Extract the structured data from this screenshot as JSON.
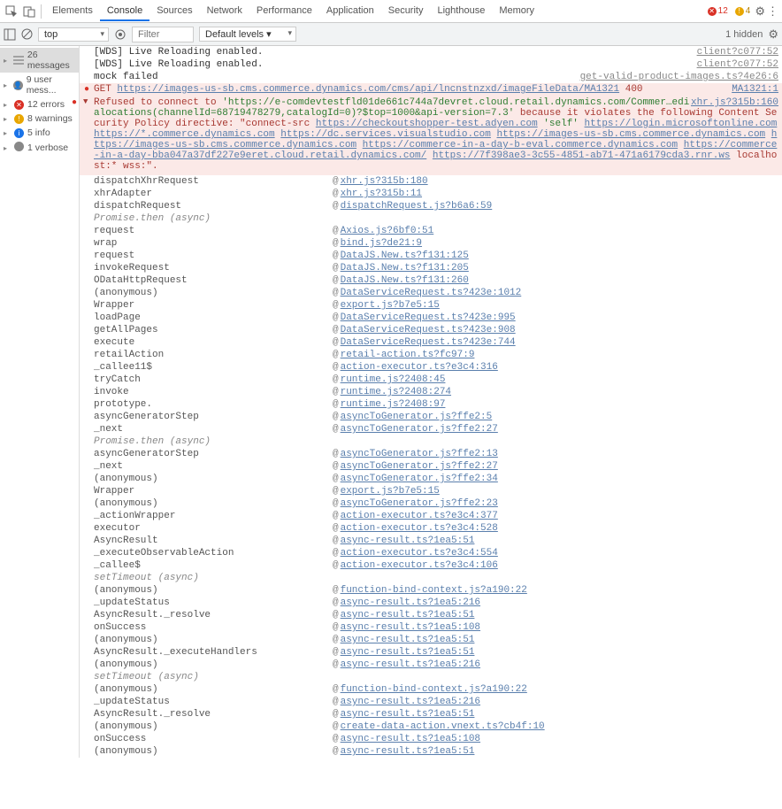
{
  "tabs": {
    "items": [
      "Elements",
      "Console",
      "Sources",
      "Network",
      "Performance",
      "Application",
      "Security",
      "Lighthouse",
      "Memory"
    ],
    "active": 1
  },
  "topRight": {
    "errCount": "12",
    "warnCount": "4"
  },
  "toolbar": {
    "context": "top",
    "filterPlaceholder": "Filter",
    "levels": "Default levels",
    "hidden": "1 hidden"
  },
  "sidebar": [
    {
      "icon": "list",
      "label": "26 messages",
      "active": true
    },
    {
      "icon": "user",
      "label": "9 user mess..."
    },
    {
      "icon": "err",
      "label": "12 errors"
    },
    {
      "icon": "warn",
      "label": "8 warnings"
    },
    {
      "icon": "info",
      "label": "5 info"
    },
    {
      "icon": "verb",
      "label": "1 verbose"
    }
  ],
  "preLines": [
    {
      "text": "[WDS] Live Reloading enabled.",
      "src": "client?c077:52",
      "err": false
    },
    {
      "text": "[WDS] Live Reloading enabled.",
      "src": "client?c077:52",
      "err": false
    },
    {
      "text": "mock failed",
      "src": "get-valid-product-images.ts?4e26:6",
      "err": false
    }
  ],
  "getLine": {
    "method": "GET",
    "url": "https://images-us-sb.cms.commerce.dynamics.com/cms/api/lncnstnzxd/imageFileData/MA1321",
    "status": "400",
    "src": "MA1321:1"
  },
  "csp": {
    "topright": "xhr.js?315b:160",
    "lead": "Refused to connect to ",
    "target": "'https://e-comdevtestfld01de661c744a7devret.cloud.retail.dynamics.com/Commer…edialocations(channelId=68719478279,catalogId=0)?$top=1000&api-version=7.3'",
    "mid": " because it violates the following Content Security Policy directive: \"connect-src ",
    "links": [
      "https://checkoutshopper-test.adyen.com",
      "'self'",
      "https://login.microsoftonline.com",
      "https://*.commerce.dynamics.com",
      "https://dc.services.visualstudio.com",
      "https://images-us-sb.cms.commerce.dynamics.com",
      "https://images-us-sb.cms.commerce.dynamics.com",
      "https://commerce-in-a-day-b-eval.commerce.dynamics.com",
      "https://commerce-in-a-day-bba047a37df227e9eret.cloud.retail.dynamics.com/",
      "https://7f398ae3-3c55-4851-ab71-471a6179cda3.rnr.ws"
    ],
    "tail": " localhost:* wss:\"."
  },
  "stack": [
    {
      "fn": "dispatchXhrRequest",
      "loc": "xhr.js?315b:180"
    },
    {
      "fn": "xhrAdapter",
      "loc": "xhr.js?315b:11"
    },
    {
      "fn": "dispatchRequest",
      "loc": "dispatchRequest.js?b6a6:59"
    },
    {
      "hdr": "Promise.then (async)"
    },
    {
      "fn": "request",
      "loc": "Axios.js?6bf0:51"
    },
    {
      "fn": "wrap",
      "loc": "bind.js?de21:9"
    },
    {
      "fn": "request",
      "loc": "DataJS.New.ts?f131:125"
    },
    {
      "fn": "invokeRequest",
      "loc": "DataJS.New.ts?f131:205"
    },
    {
      "fn": "ODataHttpRequest",
      "loc": "DataJS.New.ts?f131:260"
    },
    {
      "fn": "(anonymous)",
      "loc": "DataServiceRequest.ts?423e:1012"
    },
    {
      "fn": "Wrapper",
      "loc": "export.js?b7e5:15"
    },
    {
      "fn": "loadPage",
      "loc": "DataServiceRequest.ts?423e:995"
    },
    {
      "fn": "getAllPages",
      "loc": "DataServiceRequest.ts?423e:908"
    },
    {
      "fn": "execute",
      "loc": "DataServiceRequest.ts?423e:744"
    },
    {
      "fn": "retailAction",
      "loc": "retail-action.ts?fc97:9"
    },
    {
      "fn": "_callee11$",
      "loc": "action-executor.ts?e3c4:316"
    },
    {
      "fn": "tryCatch",
      "loc": "runtime.js?2408:45"
    },
    {
      "fn": "invoke",
      "loc": "runtime.js?2408:274"
    },
    {
      "fn": "prototype.<computed>",
      "loc": "runtime.js?2408:97"
    },
    {
      "fn": "asyncGeneratorStep",
      "loc": "asyncToGenerator.js?ffe2:5"
    },
    {
      "fn": "_next",
      "loc": "asyncToGenerator.js?ffe2:27"
    },
    {
      "hdr": "Promise.then (async)"
    },
    {
      "fn": "asyncGeneratorStep",
      "loc": "asyncToGenerator.js?ffe2:13"
    },
    {
      "fn": "_next",
      "loc": "asyncToGenerator.js?ffe2:27"
    },
    {
      "fn": "(anonymous)",
      "loc": "asyncToGenerator.js?ffe2:34"
    },
    {
      "fn": "Wrapper",
      "loc": "export.js?b7e5:15"
    },
    {
      "fn": "(anonymous)",
      "loc": "asyncToGenerator.js?ffe2:23"
    },
    {
      "fn": "_actionWrapper",
      "loc": "action-executor.ts?e3c4:377"
    },
    {
      "fn": "executor",
      "loc": "action-executor.ts?e3c4:528"
    },
    {
      "fn": "AsyncResult",
      "loc": "async-result.ts?1ea5:51"
    },
    {
      "fn": "_executeObservableAction",
      "loc": "action-executor.ts?e3c4:554"
    },
    {
      "fn": "_callee$",
      "loc": "action-executor.ts?e3c4:106"
    },
    {
      "hdr": "setTimeout (async)"
    },
    {
      "fn": "(anonymous)",
      "loc": "function-bind-context.js?a190:22"
    },
    {
      "fn": "_updateStatus",
      "loc": "async-result.ts?1ea5:216"
    },
    {
      "fn": "AsyncResult._resolve",
      "loc": "async-result.ts?1ea5:51"
    },
    {
      "fn": "onSuccess",
      "loc": "async-result.ts?1ea5:108"
    },
    {
      "fn": "(anonymous)",
      "loc": "async-result.ts?1ea5:51"
    },
    {
      "fn": "AsyncResult._executeHandlers",
      "loc": "async-result.ts?1ea5:51"
    },
    {
      "fn": "(anonymous)",
      "loc": "async-result.ts?1ea5:216"
    },
    {
      "hdr": "setTimeout (async)"
    },
    {
      "fn": "(anonymous)",
      "loc": "function-bind-context.js?a190:22"
    },
    {
      "fn": "_updateStatus",
      "loc": "async-result.ts?1ea5:216"
    },
    {
      "fn": "AsyncResult._resolve",
      "loc": "async-result.ts?1ea5:51"
    },
    {
      "fn": "(anonymous)",
      "loc": "create-data-action.vnext.ts?cb4f:10"
    },
    {
      "fn": "onSuccess",
      "loc": "async-result.ts?1ea5:108"
    },
    {
      "fn": "(anonymous)",
      "loc": "async-result.ts?1ea5:51"
    }
  ]
}
